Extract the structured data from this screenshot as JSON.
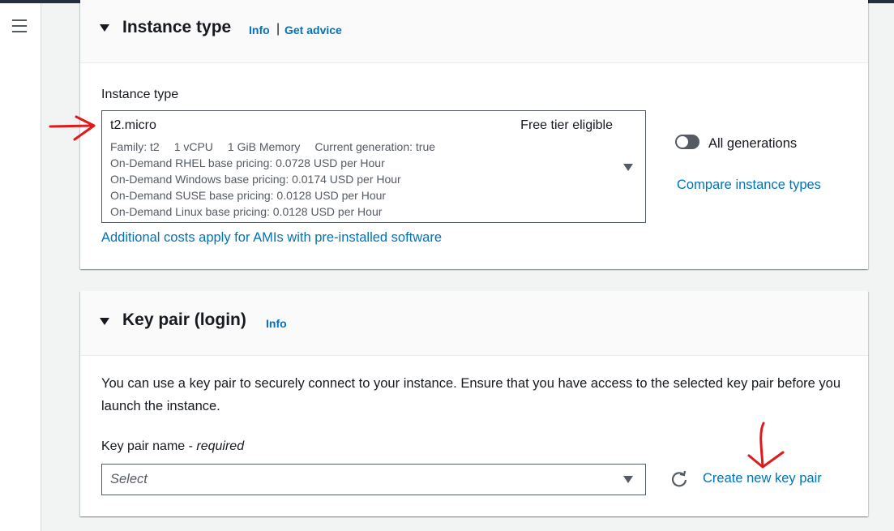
{
  "nav": {
    "menu_icon": "hamburger-menu-icon"
  },
  "instance_type_section": {
    "title": "Instance type",
    "info_link": "Info",
    "separator": "|",
    "advice_link": "Get advice",
    "field_label": "Instance type",
    "selected": {
      "name": "t2.micro",
      "badge": "Free tier eligible",
      "family": "Family: t2",
      "vcpu": "1 vCPU",
      "memory": "1 GiB Memory",
      "generation": "Current generation: true",
      "pricing": [
        "On-Demand RHEL base pricing: 0.0728 USD per Hour",
        "On-Demand Windows base pricing: 0.0174 USD per Hour",
        "On-Demand SUSE base pricing: 0.0128 USD per Hour",
        "On-Demand Linux base pricing: 0.0128 USD per Hour"
      ]
    },
    "all_generations_label": "All generations",
    "compare_link": "Compare instance types",
    "additional_costs_link": "Additional costs apply for AMIs with pre-installed software"
  },
  "key_pair_section": {
    "title": "Key pair (login)",
    "info_link": "Info",
    "description": "You can use a key pair to securely connect to your instance. Ensure that you have access to the selected key pair before you launch the instance.",
    "field_label": "Key pair name - ",
    "field_required": "required",
    "placeholder": "Select",
    "create_link": "Create new key pair"
  },
  "colors": {
    "link": "#0073bb",
    "annotation": "#e0191b",
    "topbar": "#232f3e"
  }
}
